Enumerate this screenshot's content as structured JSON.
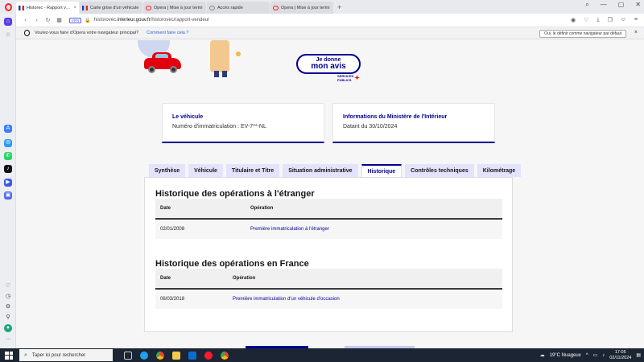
{
  "browser": {
    "tabs": [
      {
        "label": "Historec - Rapport vendeur",
        "favicon": "fr-flag",
        "active": true
      },
      {
        "label": "Carte grise d'un véhicule",
        "favicon": "fr-flag",
        "active": false
      },
      {
        "label": "Opera | Mise à jour termi",
        "favicon": "opera",
        "active": false
      },
      {
        "label": "Accès rapide",
        "favicon": "speed-dial",
        "active": false
      },
      {
        "label": "Opera | Mise à jour termi",
        "favicon": "opera",
        "active": false
      }
    ],
    "vpn_label": "VPN",
    "url_prefix": "historovec.",
    "url_domain": "interieur.gouv.fr",
    "url_path": "/historovec/rapport-vendeur",
    "default_prompt": {
      "text": "Voulez-vous faire d'Opera votre navigateur principal?",
      "link": "Comment faire cela ?",
      "button": "Oui, le définir comme navigateur par défaut"
    }
  },
  "page": {
    "avis_line1": "Je donne",
    "avis_line2": "mon avis",
    "sp_line1": "SERVICES",
    "sp_line2": "PUBLICS",
    "vehicle_card": {
      "title": "Le véhicule",
      "text": "Numéro d'immatriculation : EV-7**-NL"
    },
    "ministry_card": {
      "title": "Informations du Ministère de l'Intérieur",
      "text": "Datant du 30/10/2024"
    },
    "tabs": [
      "Synthèse",
      "Véhicule",
      "Titulaire et Titre",
      "Situation administrative",
      "Historique",
      "Contrôles techniques",
      "Kilométrage"
    ],
    "active_tab": "Historique",
    "foreign": {
      "title": "Historique des opérations à l'étranger",
      "col_date": "Date",
      "col_operation": "Opération",
      "rows": [
        {
          "date": "02/01/2008",
          "operation": "Première immatriculation à l'étranger"
        }
      ]
    },
    "france": {
      "title": "Historique des opérations en France",
      "col_date": "Date",
      "col_operation": "Opération",
      "rows": [
        {
          "date": "06/03/2018",
          "operation": "Première immatriculation d'un véhicule d'occasion"
        }
      ]
    }
  },
  "taskbar": {
    "search_placeholder": "Taper ici pour rechercher",
    "weather": "19°C  Nuageux",
    "time": "17:05",
    "date": "02/11/2024"
  },
  "colors": {
    "accent": "#000091",
    "opera_red": "#ff1b2d",
    "tab_bg": "#e3e3fd"
  }
}
